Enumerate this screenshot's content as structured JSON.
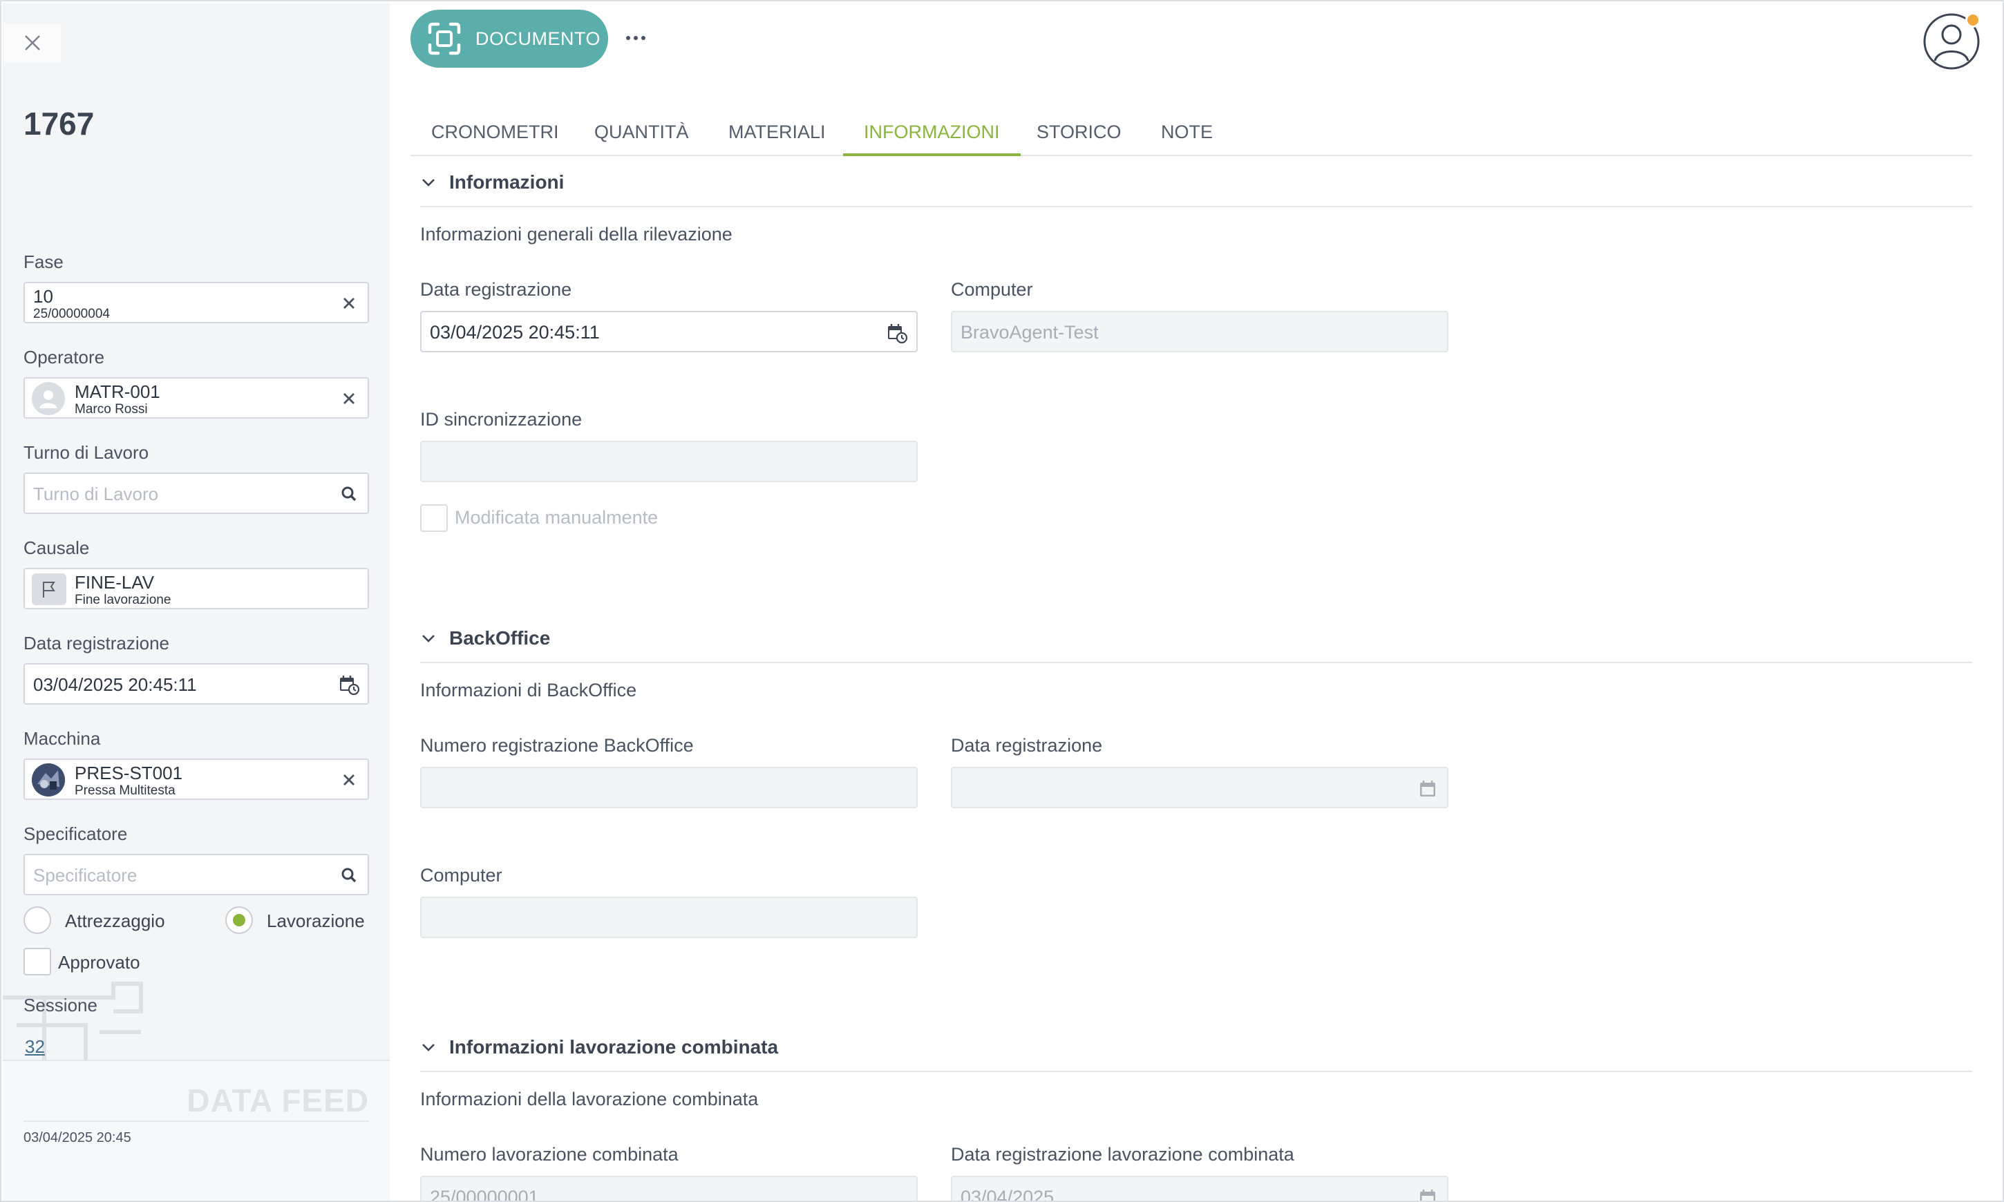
{
  "record": {
    "title": "1767"
  },
  "left": {
    "fase": {
      "label": "Fase",
      "value": "10",
      "sub": "25/00000004"
    },
    "operatore": {
      "label": "Operatore",
      "value": "MATR-001",
      "sub": "Marco Rossi"
    },
    "turno": {
      "label": "Turno di Lavoro",
      "placeholder": "Turno di Lavoro"
    },
    "causale": {
      "label": "Causale",
      "value": "FINE-LAV",
      "sub": "Fine lavorazione"
    },
    "data_registrazione": {
      "label": "Data registrazione",
      "value": "03/04/2025 20:45:11"
    },
    "macchina": {
      "label": "Macchina",
      "value": "PRES-ST001",
      "sub": "Pressa Multitesta"
    },
    "specificatore": {
      "label": "Specificatore",
      "placeholder": "Specificatore"
    },
    "radio_attrezzaggio": {
      "label": "Attrezzaggio",
      "selected": false
    },
    "radio_lavorazione": {
      "label": "Lavorazione",
      "selected": true
    },
    "approvato": {
      "label": "Approvato",
      "checked": false
    },
    "sessione": {
      "label": "Sessione",
      "value": "32"
    },
    "footer": {
      "brand": "DATA FEED",
      "timestamp": "03/04/2025 20:45"
    }
  },
  "toolbar": {
    "document_label": "DOCUMENTO"
  },
  "tabs": [
    {
      "label": "CRONOMETRI"
    },
    {
      "label": "QUANTITÀ"
    },
    {
      "label": "MATERIALI"
    },
    {
      "label": "INFORMAZIONI",
      "active": true
    },
    {
      "label": "STORICO"
    },
    {
      "label": "NOTE"
    }
  ],
  "sections": {
    "informazioni": {
      "title": "Informazioni",
      "description": "Informazioni generali della rilevazione",
      "data_registrazione": {
        "label": "Data registrazione",
        "value": "03/04/2025 20:45:11"
      },
      "computer": {
        "label": "Computer",
        "value": "BravoAgent-Test"
      },
      "id_sincronizzazione": {
        "label": "ID sincronizzazione",
        "value": ""
      },
      "modificata": {
        "label": "Modificata manualmente",
        "checked": false
      }
    },
    "backoffice": {
      "title": "BackOffice",
      "description": "Informazioni di BackOffice",
      "numero": {
        "label": "Numero registrazione BackOffice",
        "value": ""
      },
      "data_registrazione": {
        "label": "Data registrazione",
        "value": ""
      },
      "computer": {
        "label": "Computer",
        "value": ""
      }
    },
    "combinata": {
      "title": "Informazioni lavorazione combinata",
      "description": "Informazioni della lavorazione combinata",
      "numero": {
        "label": "Numero lavorazione combinata",
        "value": "25/00000001"
      },
      "data": {
        "label": "Data registrazione lavorazione combinata",
        "value": "03/04/2025"
      }
    }
  },
  "colors": {
    "accent": "#8bb43c",
    "document_button": "#5aaeab",
    "badge": "#f0a83a"
  }
}
